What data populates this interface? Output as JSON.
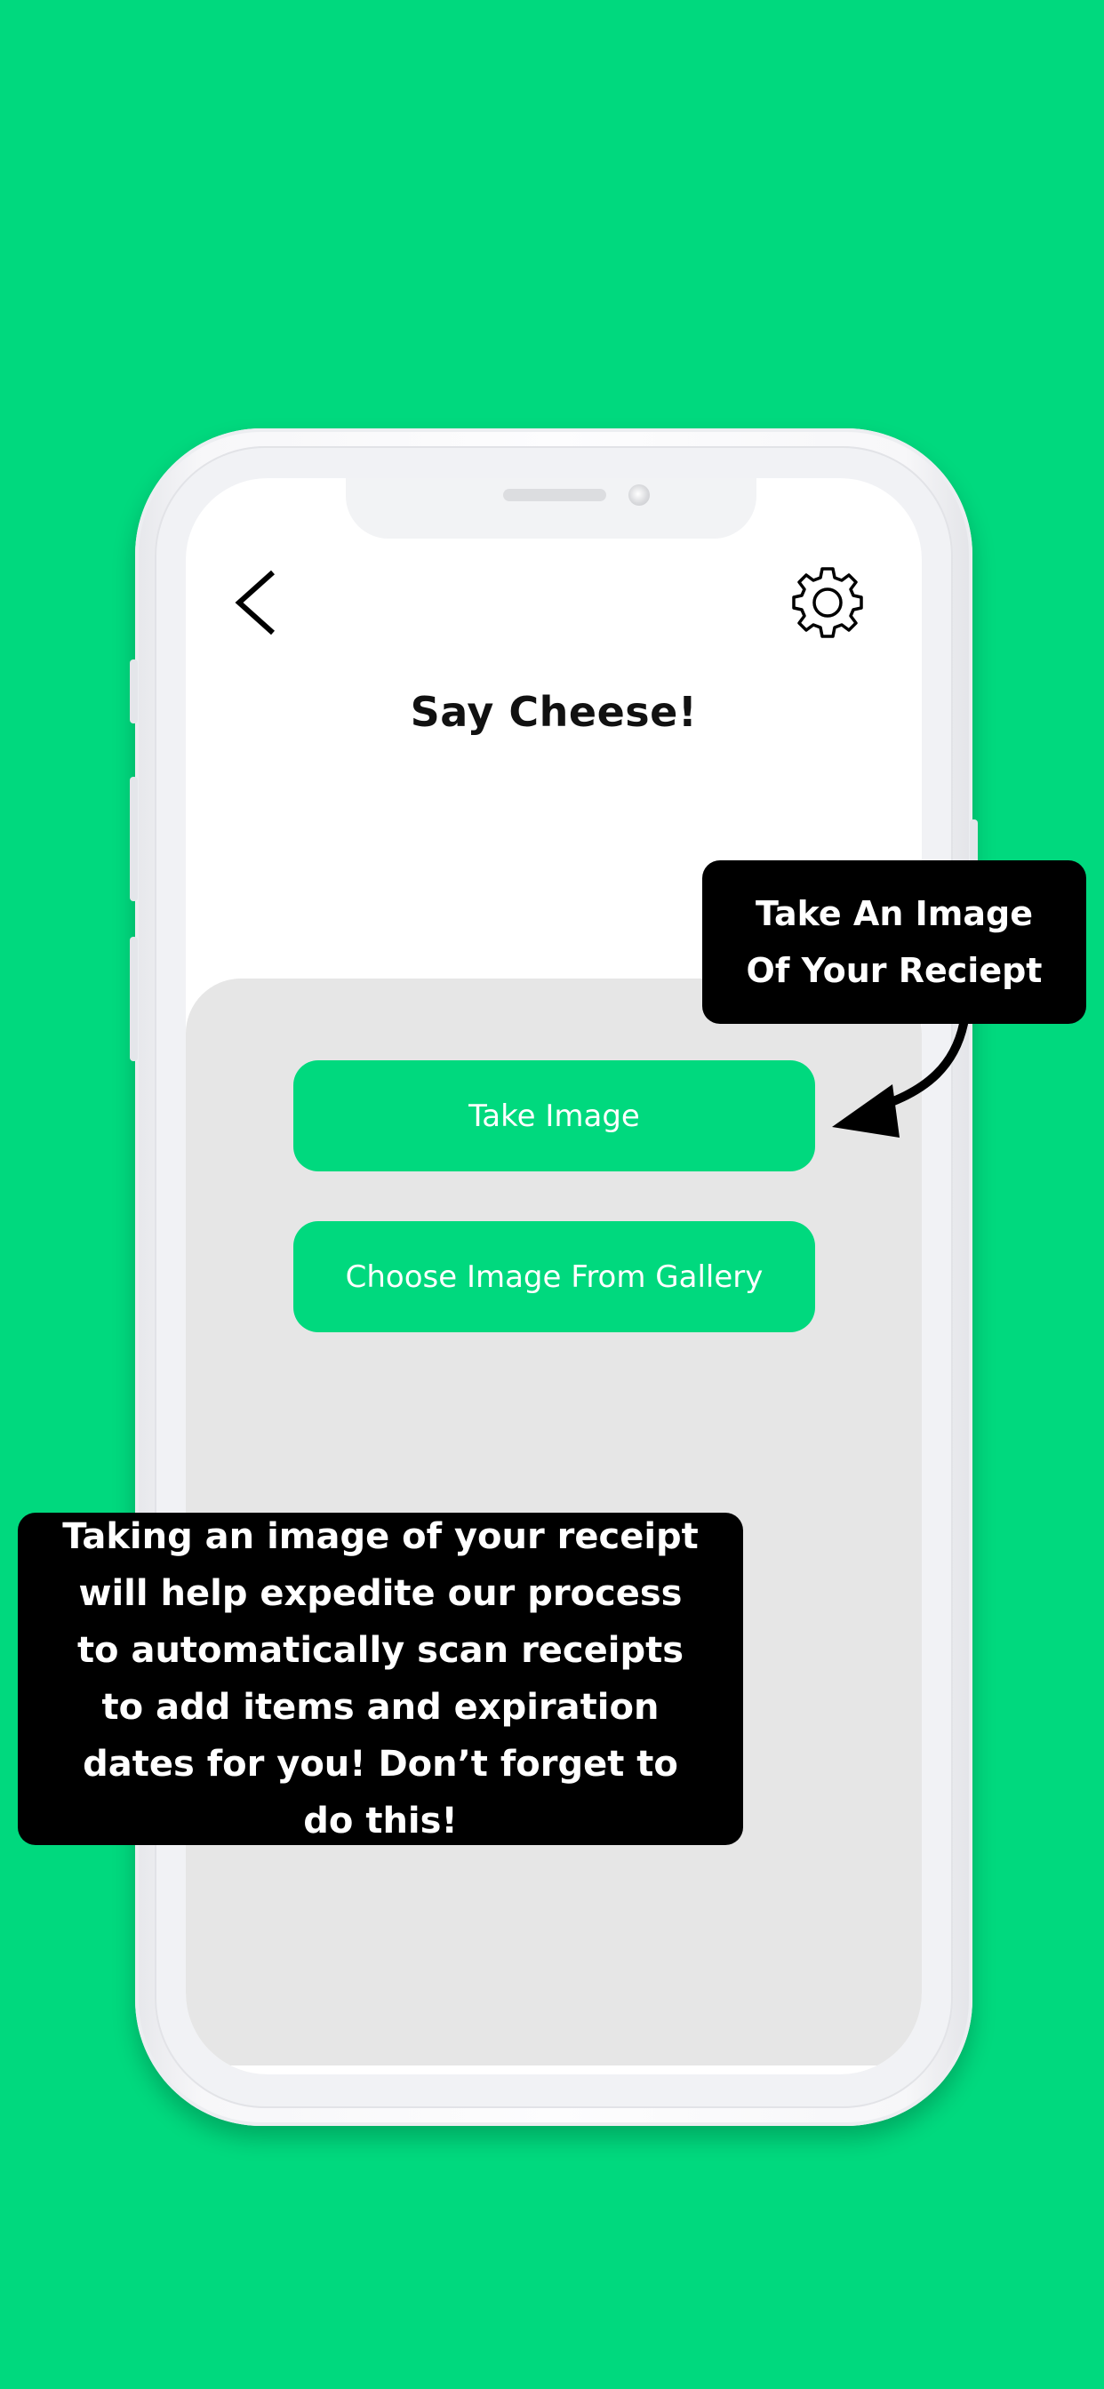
{
  "screen": {
    "title": "Say Cheese!",
    "back_icon": "chevron-left-icon",
    "settings_icon": "gear-icon"
  },
  "actions": {
    "take_image_label": "Take Image",
    "gallery_label": "Choose Image From Gallery"
  },
  "callouts": {
    "top_text": "Take An Image Of Your Reciept",
    "bottom_text": "Taking an image of your receipt will help expedite our process to automatically scan  receipts to add items and expiration dates for you! Don’t forget to do this!"
  },
  "colors": {
    "background": "#00d97e",
    "button": "#00d97e",
    "panel": "#e6e6e6",
    "callout": "#000000"
  }
}
